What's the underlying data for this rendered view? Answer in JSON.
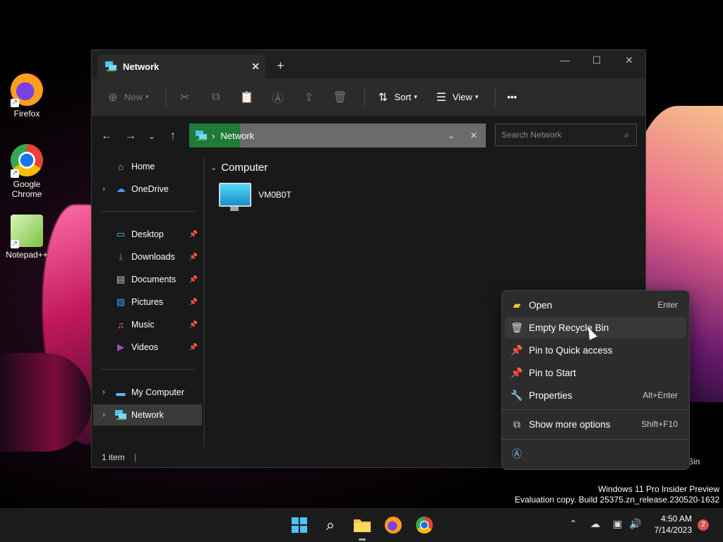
{
  "desktop": {
    "icons": [
      {
        "label": "Firefox"
      },
      {
        "label": "Google Chrome"
      },
      {
        "label": "Notepad++"
      }
    ],
    "recycle_bin_partial_label": "e Bin"
  },
  "window": {
    "tab_title": "Network",
    "new_tab": "+",
    "controls": {
      "minimize": "—",
      "maximize": "☐",
      "close": "✕"
    },
    "toolbar": {
      "new_label": "New",
      "sort_label": "Sort",
      "view_label": "View",
      "more_label": "•••"
    },
    "address": {
      "separator": "›",
      "location": "Network"
    },
    "search_placeholder": "Search Network",
    "sidebar": {
      "home": "Home",
      "onedrive": "OneDrive",
      "desktop": "Desktop",
      "downloads": "Downloads",
      "documents": "Documents",
      "pictures": "Pictures",
      "music": "Music",
      "videos": "Videos",
      "my_computer": "My Computer",
      "network": "Network"
    },
    "content": {
      "group_header": "Computer",
      "items": [
        {
          "name": "VM0B0T"
        }
      ]
    },
    "status": "1 item"
  },
  "context_menu": {
    "items": [
      {
        "label": "Open",
        "shortcut": "Enter"
      },
      {
        "label": "Empty Recycle Bin",
        "shortcut": ""
      },
      {
        "label": "Pin to Quick access",
        "shortcut": ""
      },
      {
        "label": "Pin to Start",
        "shortcut": ""
      },
      {
        "label": "Properties",
        "shortcut": "Alt+Enter"
      },
      {
        "label": "Show more options",
        "shortcut": "Shift+F10"
      }
    ]
  },
  "watermark": {
    "line1": "Windows 11 Pro Insider Preview",
    "line2": "Evaluation copy. Build 25375.zn_release.230520-1632"
  },
  "taskbar": {
    "time": "4:50 AM",
    "date": "7/14/2023",
    "notification_count": "2"
  }
}
